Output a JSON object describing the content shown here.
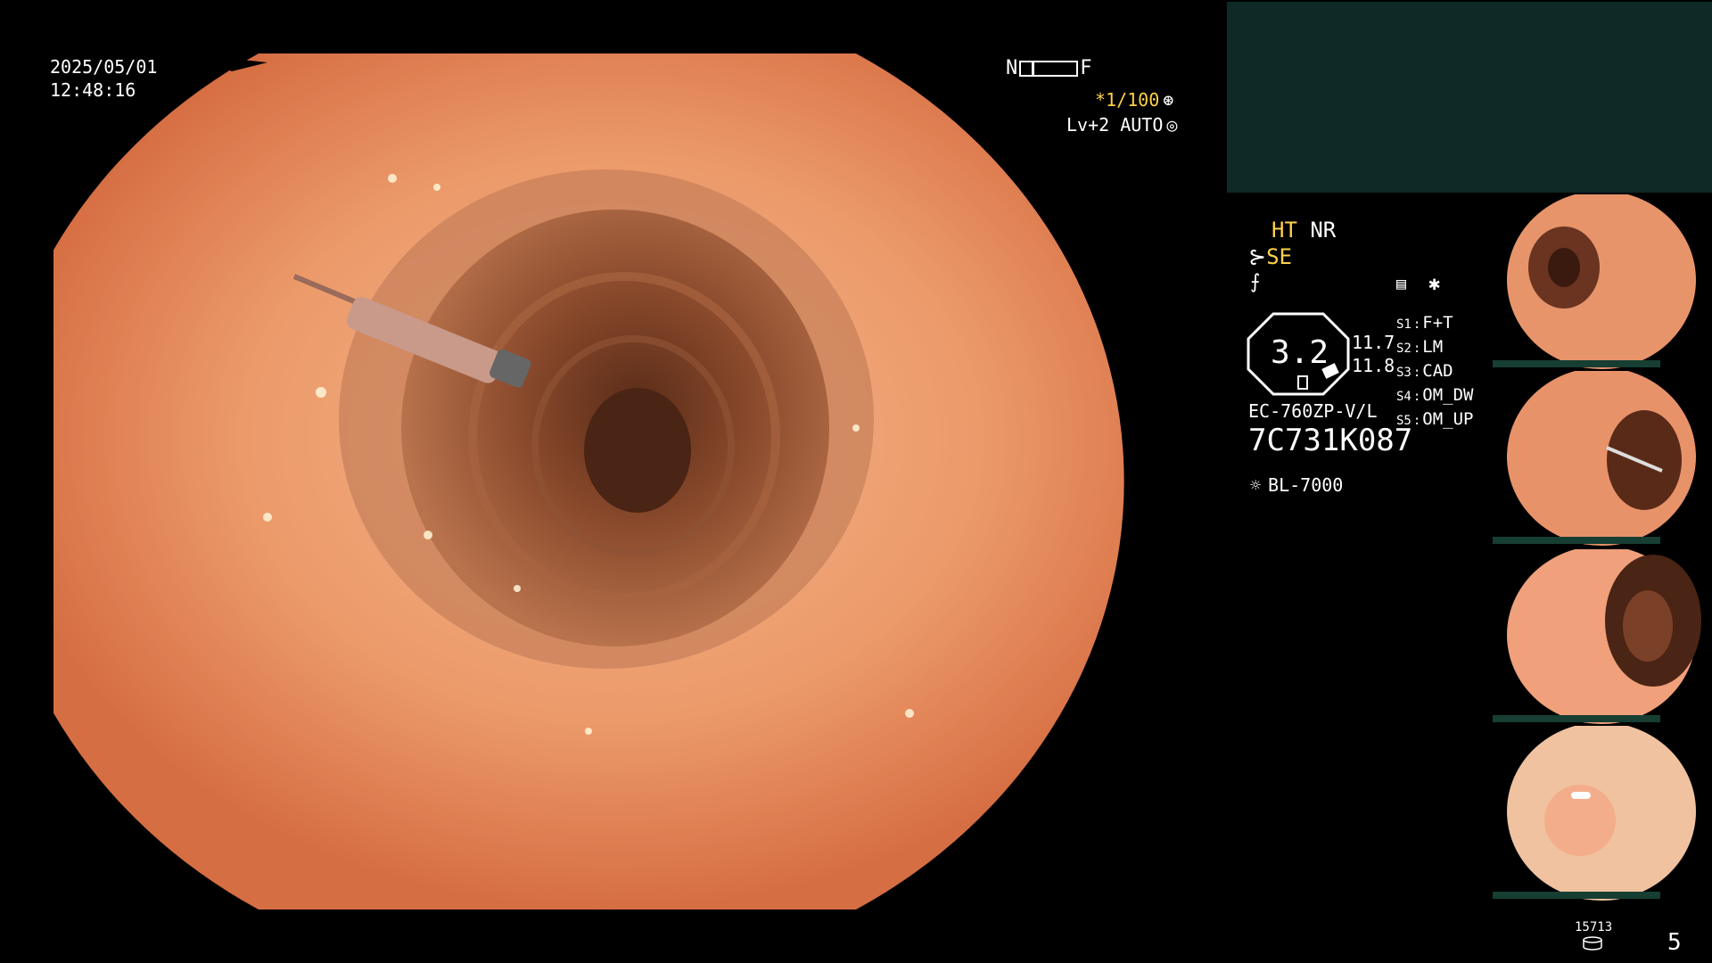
{
  "datetime": {
    "date": "2025/05/01",
    "time": "12:48:16"
  },
  "nf": {
    "near": "N",
    "far": "F"
  },
  "shutter": {
    "value": "*1/100",
    "icon": "aperture-icon"
  },
  "iris": {
    "value": "Lv+2 AUTO",
    "icon": "auto-iris-icon"
  },
  "image_mode": {
    "ht": "HT",
    "nr": "NR",
    "se": "SE"
  },
  "zoom": {
    "value": "3.2",
    "side_top": "11.7",
    "side_bottom": "11.8"
  },
  "scope_keys": [
    {
      "key": "S1",
      "sep": ":",
      "label": "F+T"
    },
    {
      "key": "S2",
      "sep": ":",
      "label": "LM"
    },
    {
      "key": "S3",
      "sep": ":",
      "label": "CAD"
    },
    {
      "key": "S4",
      "sep": ":",
      "label": "OM_DW"
    },
    {
      "key": "S5",
      "sep": ":",
      "label": "OM_UP"
    }
  ],
  "scope": {
    "model": "EC-760ZP-V/L",
    "serial": "7C731K087",
    "light_source": "BL-7000"
  },
  "counters": {
    "small": "15713",
    "big": "5"
  },
  "colors": {
    "overlay_yellow": "#ffd24a",
    "info_panel": "#0f2a26",
    "tissue": "#e98a5a"
  }
}
